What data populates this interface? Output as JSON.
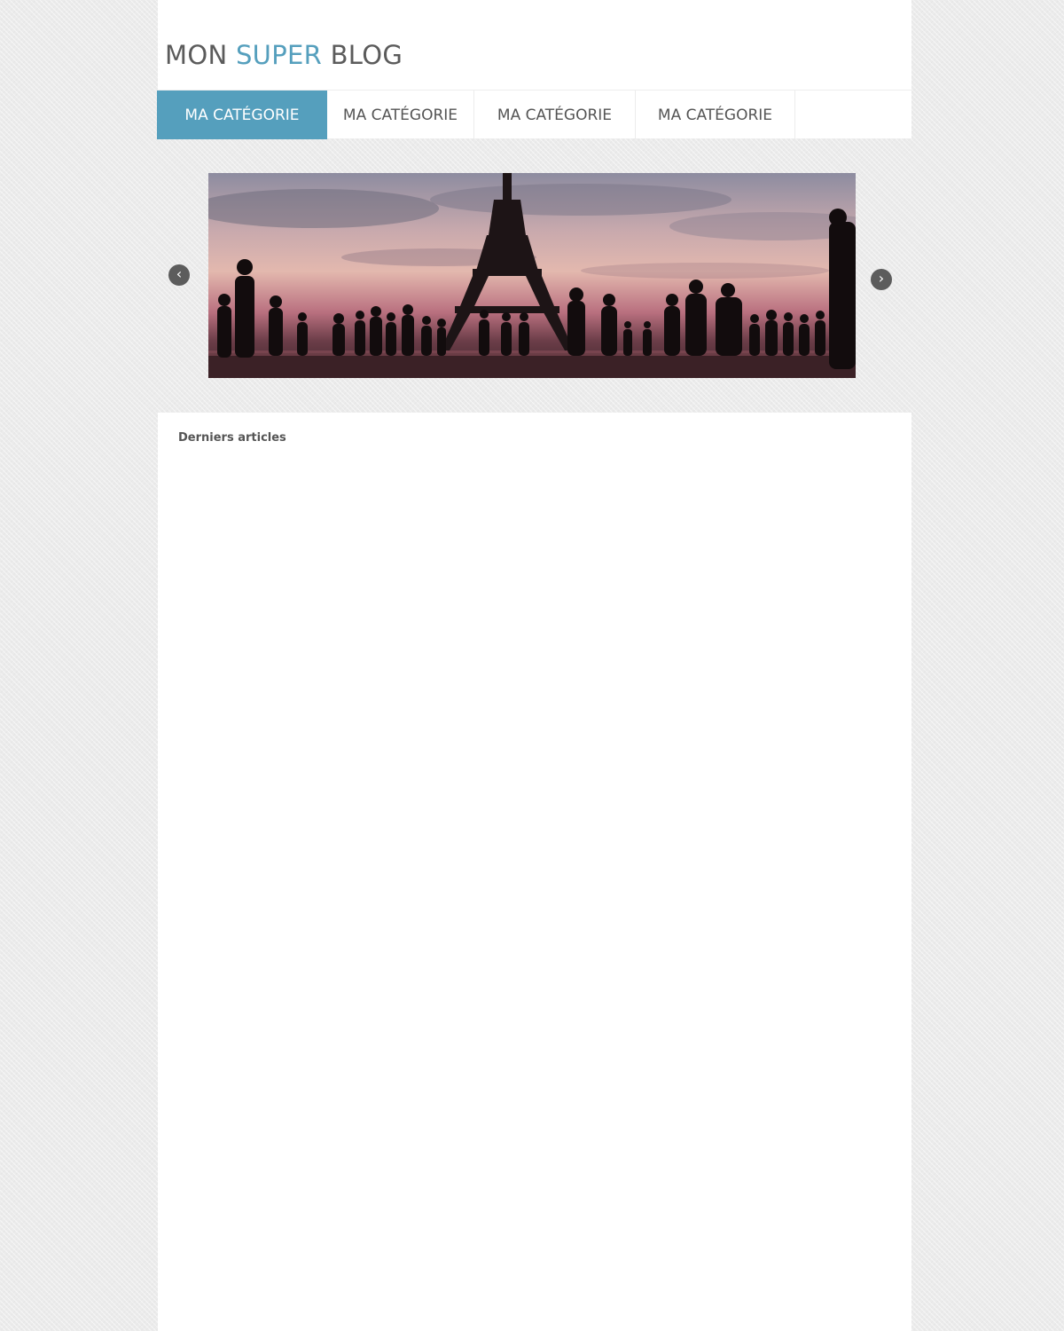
{
  "site": {
    "title_part1": "MON ",
    "title_accent": "SUPER",
    "title_part2": " BLOG",
    "accent_color": "#559fbd"
  },
  "nav": {
    "items": [
      {
        "label": "MA CATÉGORIE",
        "active": true
      },
      {
        "label": "MA CATÉGORIE",
        "active": false
      },
      {
        "label": "MA CATÉGORIE",
        "active": false
      },
      {
        "label": "MA CATÉGORIE",
        "active": false
      }
    ]
  },
  "slider": {
    "prev_icon": "‹",
    "next_icon": "›",
    "image_subject": "eiffel-tower-silhouette-crowd"
  },
  "content": {
    "section_title": "Derniers articles"
  }
}
